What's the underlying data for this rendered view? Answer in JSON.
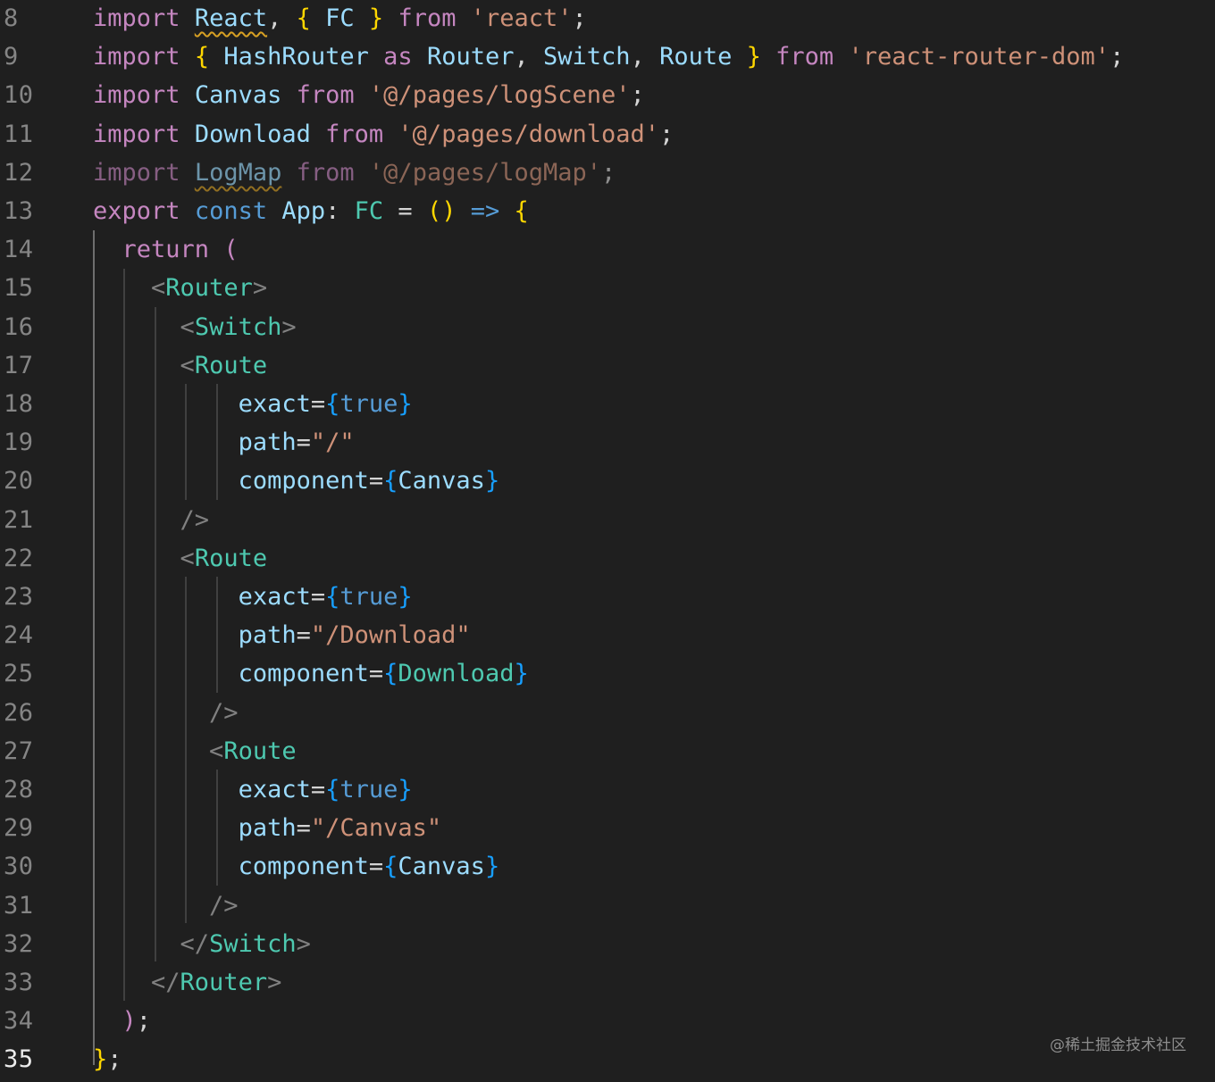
{
  "colors": {
    "background": "#1f1f1f",
    "line_number": "#858585",
    "line_number_active": "#ececec",
    "keyword": "#c586c0",
    "storage": "#569cd6",
    "variable": "#9cdcfe",
    "type": "#4ec9b0",
    "string": "#ce9178",
    "bracket_yellow": "#ffd700",
    "bracket_blue": "#179fff",
    "tag_punct": "#808080",
    "punct": "#d4d4d4",
    "squiggle": "#d7a023",
    "indent_guide": "#404040",
    "indent_guide_active": "#6e6e6e"
  },
  "editor": {
    "active_line": 35,
    "lines": [
      {
        "num": "8",
        "tokens": [
          {
            "t": "import",
            "c": "keyword"
          },
          {
            "t": " ",
            "c": "punct"
          },
          {
            "t": "React",
            "c": "variable",
            "squiggle": true
          },
          {
            "t": ", ",
            "c": "punct"
          },
          {
            "t": "{",
            "c": "bracket_yellow"
          },
          {
            "t": " ",
            "c": "punct"
          },
          {
            "t": "FC",
            "c": "variable"
          },
          {
            "t": " ",
            "c": "punct"
          },
          {
            "t": "}",
            "c": "bracket_yellow"
          },
          {
            "t": " ",
            "c": "punct"
          },
          {
            "t": "from",
            "c": "keyword"
          },
          {
            "t": " ",
            "c": "punct"
          },
          {
            "t": "'react'",
            "c": "string"
          },
          {
            "t": ";",
            "c": "punct"
          }
        ]
      },
      {
        "num": "9",
        "tokens": [
          {
            "t": "import",
            "c": "keyword"
          },
          {
            "t": " ",
            "c": "punct"
          },
          {
            "t": "{",
            "c": "bracket_yellow"
          },
          {
            "t": " ",
            "c": "punct"
          },
          {
            "t": "HashRouter",
            "c": "variable"
          },
          {
            "t": " ",
            "c": "punct"
          },
          {
            "t": "as",
            "c": "keyword"
          },
          {
            "t": " ",
            "c": "punct"
          },
          {
            "t": "Router",
            "c": "variable"
          },
          {
            "t": ", ",
            "c": "punct"
          },
          {
            "t": "Switch",
            "c": "variable"
          },
          {
            "t": ", ",
            "c": "punct"
          },
          {
            "t": "Route",
            "c": "variable"
          },
          {
            "t": " ",
            "c": "punct"
          },
          {
            "t": "}",
            "c": "bracket_yellow"
          },
          {
            "t": " ",
            "c": "punct"
          },
          {
            "t": "from",
            "c": "keyword"
          },
          {
            "t": " ",
            "c": "punct"
          },
          {
            "t": "'react-router-dom'",
            "c": "string"
          },
          {
            "t": ";",
            "c": "punct"
          }
        ]
      },
      {
        "num": "10",
        "tokens": [
          {
            "t": "import",
            "c": "keyword"
          },
          {
            "t": " ",
            "c": "punct"
          },
          {
            "t": "Canvas",
            "c": "variable"
          },
          {
            "t": " ",
            "c": "punct"
          },
          {
            "t": "from",
            "c": "keyword"
          },
          {
            "t": " ",
            "c": "punct"
          },
          {
            "t": "'@/pages/logScene'",
            "c": "string"
          },
          {
            "t": ";",
            "c": "punct"
          }
        ]
      },
      {
        "num": "11",
        "tokens": [
          {
            "t": "import",
            "c": "keyword"
          },
          {
            "t": " ",
            "c": "punct"
          },
          {
            "t": "Download",
            "c": "variable"
          },
          {
            "t": " ",
            "c": "punct"
          },
          {
            "t": "from",
            "c": "keyword"
          },
          {
            "t": " ",
            "c": "punct"
          },
          {
            "t": "'@/pages/download'",
            "c": "string"
          },
          {
            "t": ";",
            "c": "punct"
          }
        ]
      },
      {
        "num": "12",
        "dim": true,
        "tokens": [
          {
            "t": "import",
            "c": "keyword"
          },
          {
            "t": " ",
            "c": "punct"
          },
          {
            "t": "LogMap",
            "c": "variable",
            "squiggle": true
          },
          {
            "t": " ",
            "c": "punct"
          },
          {
            "t": "from",
            "c": "keyword"
          },
          {
            "t": " ",
            "c": "punct"
          },
          {
            "t": "'@/pages/logMap'",
            "c": "string"
          },
          {
            "t": ";",
            "c": "punct"
          }
        ]
      },
      {
        "num": "13",
        "tokens": [
          {
            "t": "export",
            "c": "keyword"
          },
          {
            "t": " ",
            "c": "punct"
          },
          {
            "t": "const",
            "c": "storage"
          },
          {
            "t": " ",
            "c": "punct"
          },
          {
            "t": "App",
            "c": "variable"
          },
          {
            "t": ": ",
            "c": "punct"
          },
          {
            "t": "FC",
            "c": "type"
          },
          {
            "t": " = ",
            "c": "punct"
          },
          {
            "t": "()",
            "c": "bracket_yellow"
          },
          {
            "t": " ",
            "c": "punct"
          },
          {
            "t": "=>",
            "c": "storage"
          },
          {
            "t": " ",
            "c": "punct"
          },
          {
            "t": "{",
            "c": "bracket_yellow"
          }
        ]
      },
      {
        "num": "14",
        "tokens": [
          {
            "t": "  ",
            "c": "punct"
          },
          {
            "t": "return",
            "c": "keyword"
          },
          {
            "t": " ",
            "c": "punct"
          },
          {
            "t": "(",
            "c": "keyword"
          }
        ]
      },
      {
        "num": "15",
        "tokens": [
          {
            "t": "    ",
            "c": "punct"
          },
          {
            "t": "<",
            "c": "tag_punct"
          },
          {
            "t": "Router",
            "c": "type"
          },
          {
            "t": ">",
            "c": "tag_punct"
          }
        ]
      },
      {
        "num": "16",
        "tokens": [
          {
            "t": "      ",
            "c": "punct"
          },
          {
            "t": "<",
            "c": "tag_punct"
          },
          {
            "t": "Switch",
            "c": "type"
          },
          {
            "t": ">",
            "c": "tag_punct"
          }
        ]
      },
      {
        "num": "17",
        "tokens": [
          {
            "t": "      ",
            "c": "punct"
          },
          {
            "t": "<",
            "c": "tag_punct"
          },
          {
            "t": "Route",
            "c": "type"
          }
        ]
      },
      {
        "num": "18",
        "tokens": [
          {
            "t": "          ",
            "c": "punct"
          },
          {
            "t": "exact",
            "c": "variable"
          },
          {
            "t": "=",
            "c": "punct"
          },
          {
            "t": "{",
            "c": "bracket_blue"
          },
          {
            "t": "true",
            "c": "storage"
          },
          {
            "t": "}",
            "c": "bracket_blue"
          }
        ]
      },
      {
        "num": "19",
        "tokens": [
          {
            "t": "          ",
            "c": "punct"
          },
          {
            "t": "path",
            "c": "variable"
          },
          {
            "t": "=",
            "c": "punct"
          },
          {
            "t": "\"/\"",
            "c": "string"
          }
        ]
      },
      {
        "num": "20",
        "tokens": [
          {
            "t": "          ",
            "c": "punct"
          },
          {
            "t": "component",
            "c": "variable"
          },
          {
            "t": "=",
            "c": "punct"
          },
          {
            "t": "{",
            "c": "bracket_blue"
          },
          {
            "t": "Canvas",
            "c": "variable"
          },
          {
            "t": "}",
            "c": "bracket_blue"
          }
        ]
      },
      {
        "num": "21",
        "tokens": [
          {
            "t": "      ",
            "c": "punct"
          },
          {
            "t": "/>",
            "c": "tag_punct"
          }
        ]
      },
      {
        "num": "22",
        "tokens": [
          {
            "t": "      ",
            "c": "punct"
          },
          {
            "t": "<",
            "c": "tag_punct"
          },
          {
            "t": "Route",
            "c": "type"
          }
        ]
      },
      {
        "num": "23",
        "tokens": [
          {
            "t": "          ",
            "c": "punct"
          },
          {
            "t": "exact",
            "c": "variable"
          },
          {
            "t": "=",
            "c": "punct"
          },
          {
            "t": "{",
            "c": "bracket_blue"
          },
          {
            "t": "true",
            "c": "storage"
          },
          {
            "t": "}",
            "c": "bracket_blue"
          }
        ]
      },
      {
        "num": "24",
        "tokens": [
          {
            "t": "          ",
            "c": "punct"
          },
          {
            "t": "path",
            "c": "variable"
          },
          {
            "t": "=",
            "c": "punct"
          },
          {
            "t": "\"/Download\"",
            "c": "string"
          }
        ]
      },
      {
        "num": "25",
        "tokens": [
          {
            "t": "          ",
            "c": "punct"
          },
          {
            "t": "component",
            "c": "variable"
          },
          {
            "t": "=",
            "c": "punct"
          },
          {
            "t": "{",
            "c": "bracket_blue"
          },
          {
            "t": "Download",
            "c": "type"
          },
          {
            "t": "}",
            "c": "bracket_blue"
          }
        ]
      },
      {
        "num": "26",
        "tokens": [
          {
            "t": "        ",
            "c": "punct"
          },
          {
            "t": "/>",
            "c": "tag_punct"
          }
        ]
      },
      {
        "num": "27",
        "tokens": [
          {
            "t": "        ",
            "c": "punct"
          },
          {
            "t": "<",
            "c": "tag_punct"
          },
          {
            "t": "Route",
            "c": "type"
          }
        ]
      },
      {
        "num": "28",
        "tokens": [
          {
            "t": "          ",
            "c": "punct"
          },
          {
            "t": "exact",
            "c": "variable"
          },
          {
            "t": "=",
            "c": "punct"
          },
          {
            "t": "{",
            "c": "bracket_blue"
          },
          {
            "t": "true",
            "c": "storage"
          },
          {
            "t": "}",
            "c": "bracket_blue"
          }
        ]
      },
      {
        "num": "29",
        "tokens": [
          {
            "t": "          ",
            "c": "punct"
          },
          {
            "t": "path",
            "c": "variable"
          },
          {
            "t": "=",
            "c": "punct"
          },
          {
            "t": "\"/Canvas\"",
            "c": "string"
          }
        ]
      },
      {
        "num": "30",
        "tokens": [
          {
            "t": "          ",
            "c": "punct"
          },
          {
            "t": "component",
            "c": "variable"
          },
          {
            "t": "=",
            "c": "punct"
          },
          {
            "t": "{",
            "c": "bracket_blue"
          },
          {
            "t": "Canvas",
            "c": "variable"
          },
          {
            "t": "}",
            "c": "bracket_blue"
          }
        ]
      },
      {
        "num": "31",
        "tokens": [
          {
            "t": "        ",
            "c": "punct"
          },
          {
            "t": "/>",
            "c": "tag_punct"
          }
        ]
      },
      {
        "num": "32",
        "tokens": [
          {
            "t": "      ",
            "c": "punct"
          },
          {
            "t": "</",
            "c": "tag_punct"
          },
          {
            "t": "Switch",
            "c": "type"
          },
          {
            "t": ">",
            "c": "tag_punct"
          }
        ]
      },
      {
        "num": "33",
        "tokens": [
          {
            "t": "    ",
            "c": "punct"
          },
          {
            "t": "</",
            "c": "tag_punct"
          },
          {
            "t": "Router",
            "c": "type"
          },
          {
            "t": ">",
            "c": "tag_punct"
          }
        ]
      },
      {
        "num": "34",
        "tokens": [
          {
            "t": "  ",
            "c": "punct"
          },
          {
            "t": ")",
            "c": "keyword"
          },
          {
            "t": ";",
            "c": "punct"
          }
        ]
      },
      {
        "num": "35",
        "tokens": [
          {
            "t": "}",
            "c": "bracket_yellow"
          },
          {
            "t": ";",
            "c": "punct"
          }
        ]
      }
    ]
  },
  "watermark": "@稀土掘金技术社区"
}
